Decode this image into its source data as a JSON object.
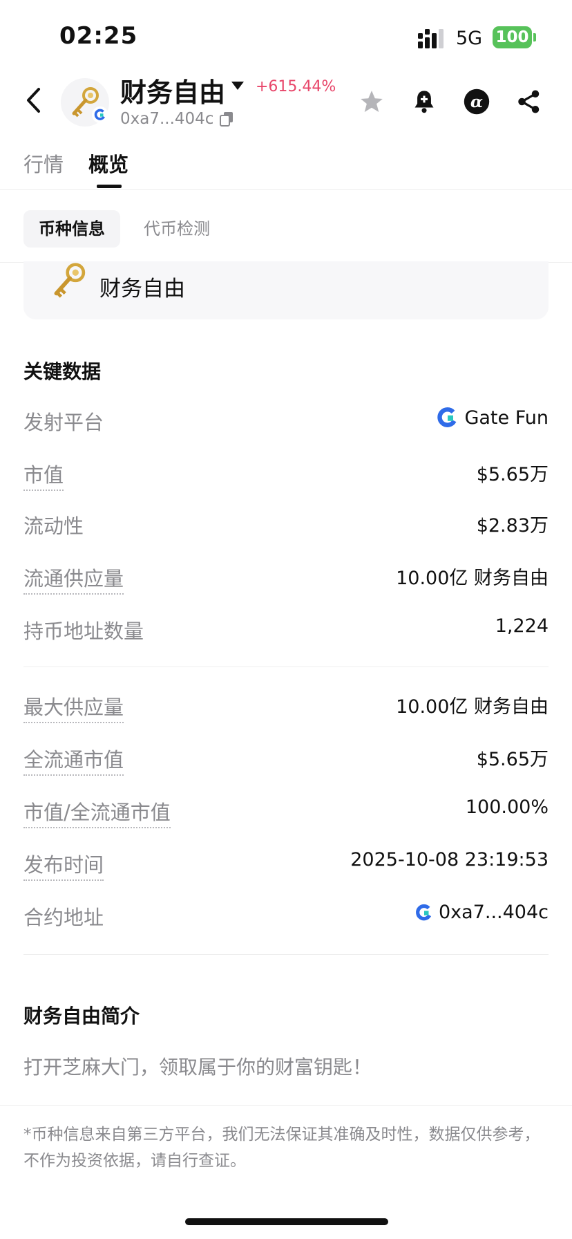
{
  "status_bar": {
    "time": "02:25",
    "network": "5G",
    "battery": "100"
  },
  "header": {
    "token_name": "财务自由",
    "change": "+615.44%",
    "address": "0xa7...404c",
    "icons": [
      "back-icon",
      "star-icon",
      "bell-plus-icon",
      "alpha-icon",
      "share-icon"
    ]
  },
  "tabs": [
    {
      "label": "行情"
    },
    {
      "label": "概览"
    }
  ],
  "subtabs": [
    {
      "label": "币种信息"
    },
    {
      "label": "代币检测"
    }
  ],
  "token_card": {
    "name": "财务自由"
  },
  "key_data": {
    "title": "关键数据",
    "rows": [
      {
        "label": "发射平台",
        "value": "Gate Fun"
      },
      {
        "label": "市值",
        "value": "$5.65万"
      },
      {
        "label": "流动性",
        "value": "$2.83万"
      },
      {
        "label": "流通供应量",
        "value": "10.00亿 财务自由"
      },
      {
        "label": "持币地址数量",
        "value": "1,224"
      },
      {
        "label": "最大供应量",
        "value": "10.00亿 财务自由"
      },
      {
        "label": "全流通市值",
        "value": "$5.65万"
      },
      {
        "label": "市值/全流通市值",
        "value": "100.00%"
      },
      {
        "label": "发布时间",
        "value": "2025-10-08 23:19:53"
      },
      {
        "label": "合约地址",
        "value": "0xa7...404c"
      }
    ]
  },
  "intro": {
    "title": "财务自由简介",
    "text": "打开芝麻大门，领取属于你的财富钥匙！"
  },
  "disclaimer": "*币种信息来自第三方平台，我们无法保证其准确及时性，数据仅供参考，不作为投资依据，请自行查证。",
  "colors": {
    "positive": "#e8466a",
    "battery": "#57c25a",
    "gate_blue": "#2f6be8",
    "gate_cyan": "#29c8c0"
  }
}
